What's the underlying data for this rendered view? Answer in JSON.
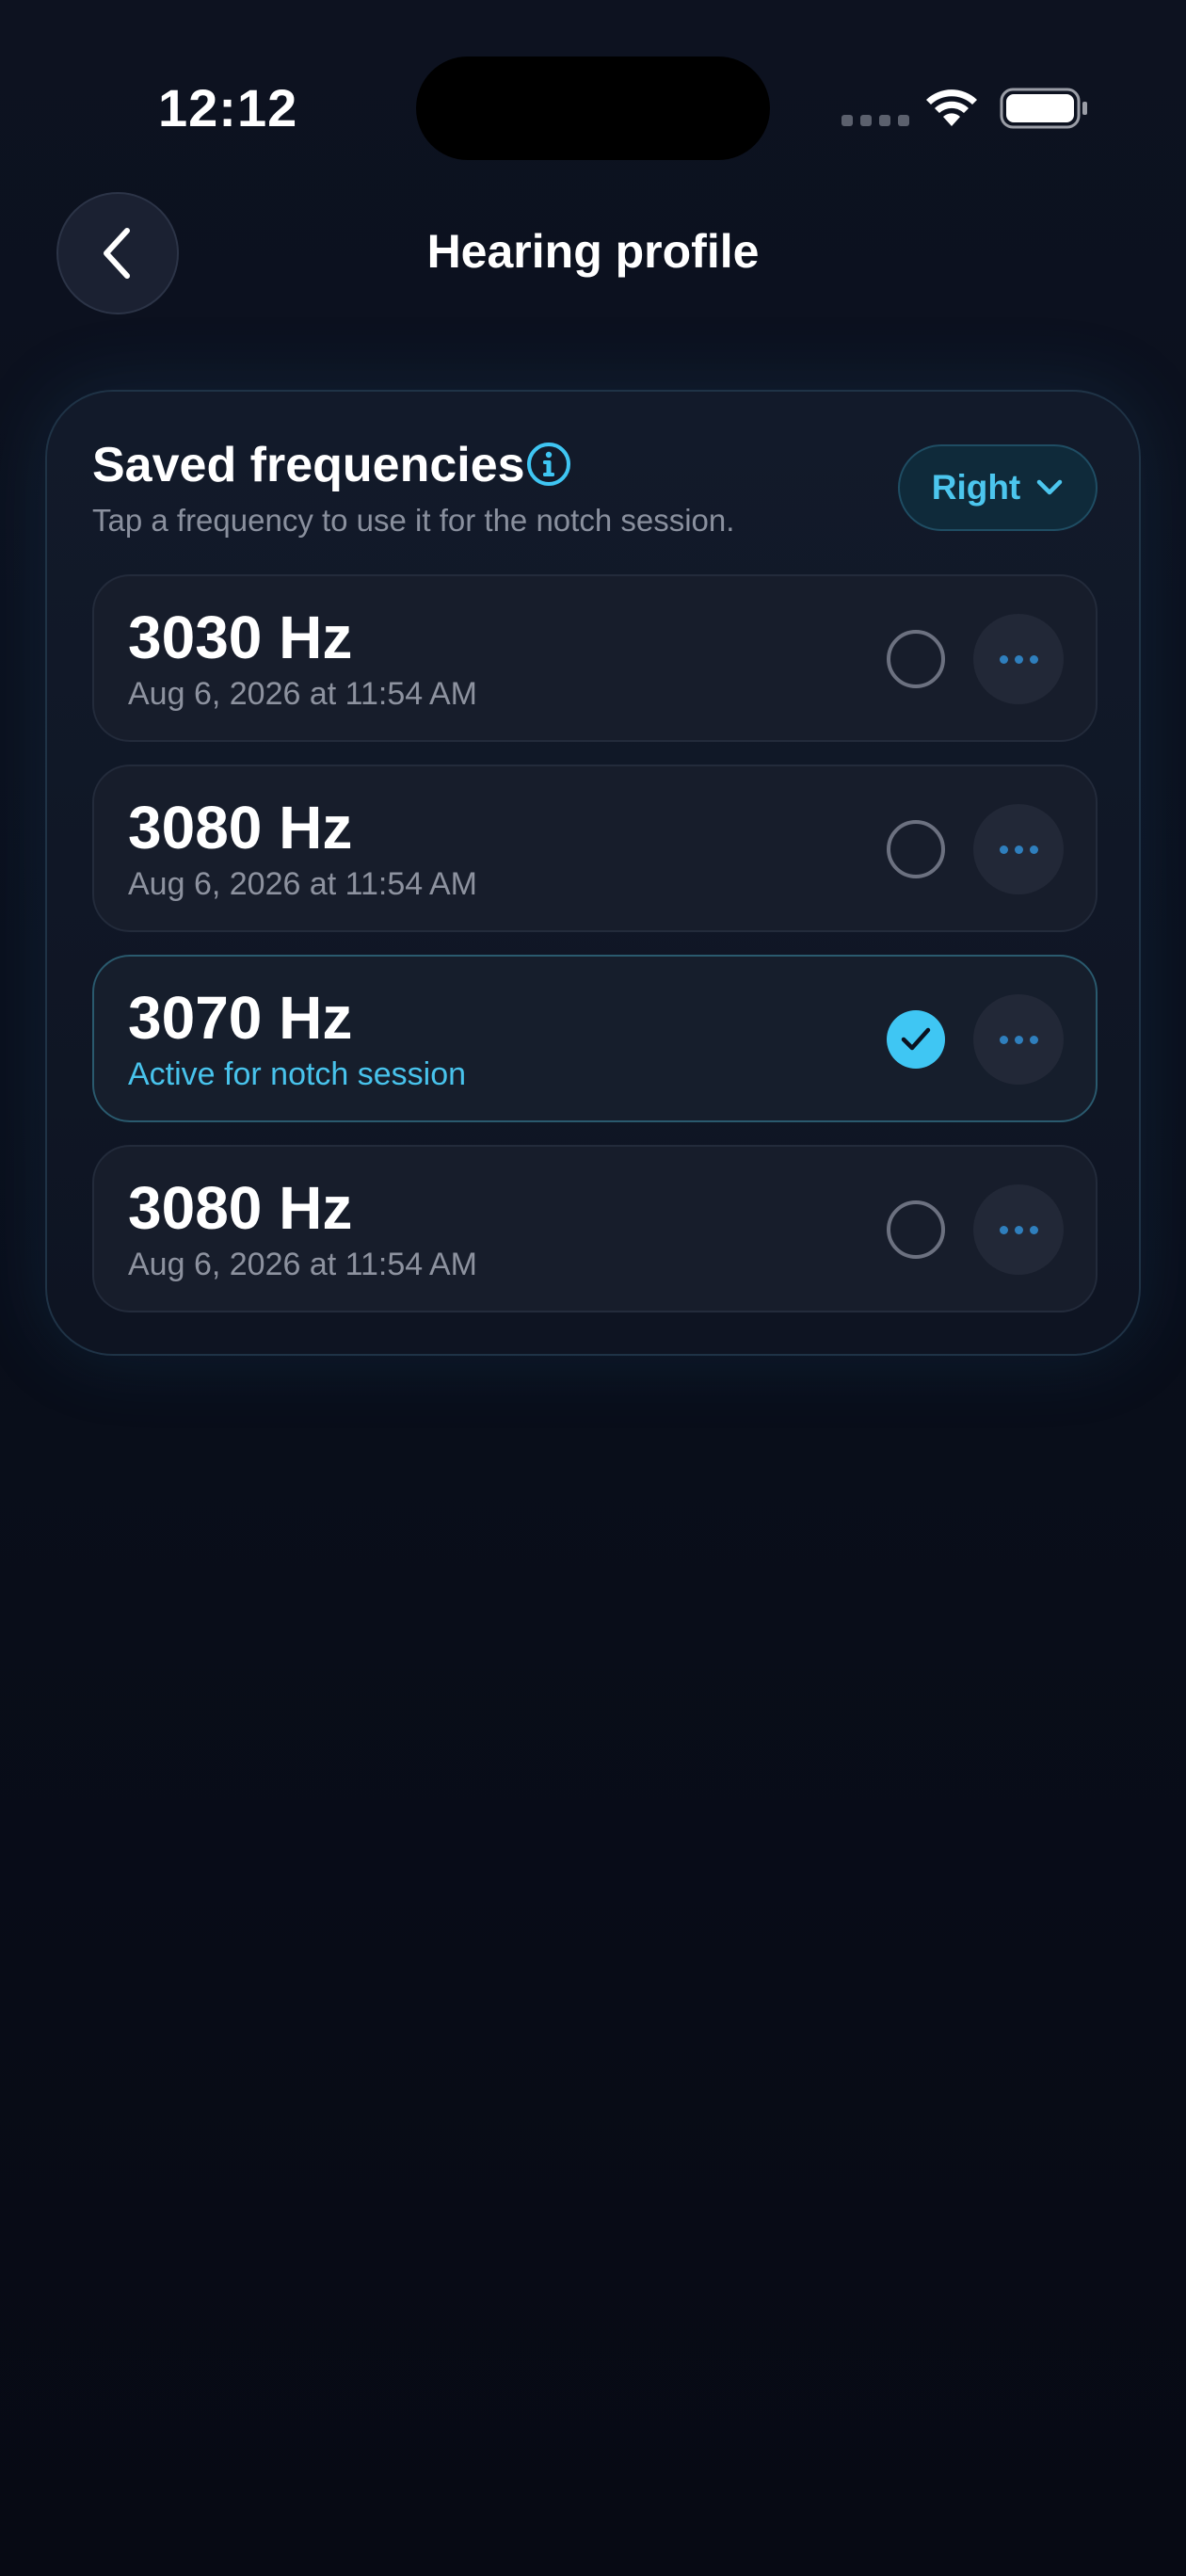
{
  "status_bar": {
    "time": "12:12"
  },
  "header": {
    "title": "Hearing profile",
    "back_icon": "chevron-left-icon"
  },
  "card": {
    "title": "Saved frequencies",
    "info_icon": "info-icon",
    "subtitle": "Tap a frequency to use it for the notch session.",
    "ear_select": {
      "value": "Right",
      "icon": "chevron-down-icon"
    },
    "items": [
      {
        "frequency": "3030 Hz",
        "meta": "Aug 6, 2026 at 11:54 AM",
        "selected": false
      },
      {
        "frequency": "3080 Hz",
        "meta": "Aug 6, 2026 at 11:54 AM",
        "selected": false
      },
      {
        "frequency": "3070 Hz",
        "meta": "Active for notch session",
        "selected": true
      },
      {
        "frequency": "3080 Hz",
        "meta": "Aug 6, 2026 at 11:54 AM",
        "selected": false
      }
    ]
  },
  "colors": {
    "accent": "#3fc6f3",
    "background": "#0a0f1c",
    "card": "#121a2a",
    "row": "#171d2b",
    "muted_text": "#8d929f",
    "more_dots": "#2f7fbd"
  }
}
